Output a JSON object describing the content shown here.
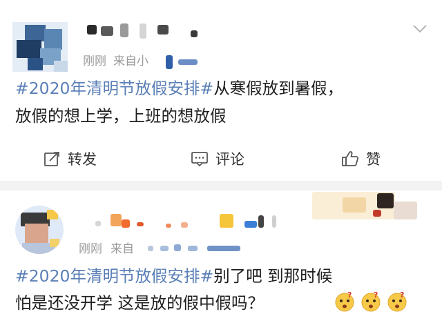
{
  "post1": {
    "time": "刚刚",
    "source": "来自小",
    "tag": "#2020年清明节放假安排#",
    "line1_rest": "从寒假放到暑假，",
    "line2": "放假的想上学，上班的想放假",
    "actions": {
      "repost": "转发",
      "comment": "评论",
      "like": "赞"
    }
  },
  "post2": {
    "time": "刚刚",
    "source": "来自",
    "tag": "#2020年清明节放假安排#",
    "line1_rest": "别了吧  到那时候",
    "line2": "怕是还没开学  这是放的假中假吗？"
  },
  "icons": {
    "menu": "chevron-down-icon",
    "repost": "repost-icon",
    "comment": "comment-icon",
    "like": "thumbs-up-icon",
    "emoji": "confused-face-emoji"
  },
  "colors": {
    "tag": "#5a7fb6",
    "meta": "#9a9a9a",
    "separator": "#f2f2f2"
  }
}
